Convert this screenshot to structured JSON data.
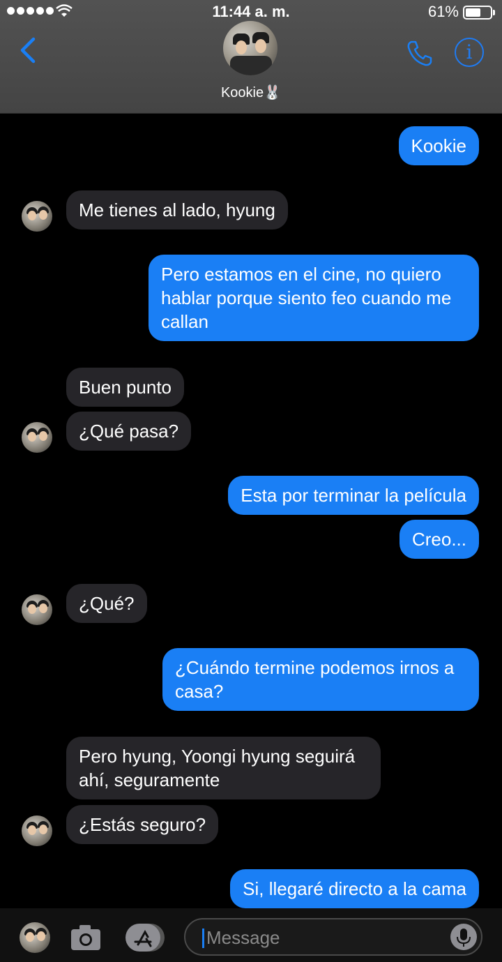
{
  "status": {
    "time": "11:44 a. m.",
    "battery": "61%",
    "battery_level": 0.61
  },
  "header": {
    "contact_name": "Kookie🐰"
  },
  "messages": [
    {
      "dir": "out",
      "text": "Kookie"
    },
    {
      "dir": "in",
      "text": "Me tienes al lado, hyung"
    },
    {
      "dir": "out",
      "text": "Pero estamos en el cine, no quiero hablar porque siento feo cuando me callan"
    },
    {
      "dir": "in",
      "text": "Buen punto"
    },
    {
      "dir": "in",
      "text": "¿Qué pasa?"
    },
    {
      "dir": "out",
      "text": "Esta por terminar la película"
    },
    {
      "dir": "out",
      "text": "Creo..."
    },
    {
      "dir": "in",
      "text": "¿Qué?"
    },
    {
      "dir": "out",
      "text": "¿Cuándo termine podemos irnos a casa?"
    },
    {
      "dir": "in",
      "text": "Pero hyung, Yoongi hyung seguirá ahí, seguramente"
    },
    {
      "dir": "in",
      "text": "¿Estás seguro?"
    },
    {
      "dir": "out",
      "text": "Si, llegaré directo a la cama"
    }
  ],
  "composer": {
    "placeholder": "Message"
  },
  "colors": {
    "accent": "#1a7ff5",
    "incoming": "#262529",
    "background": "#000000"
  }
}
